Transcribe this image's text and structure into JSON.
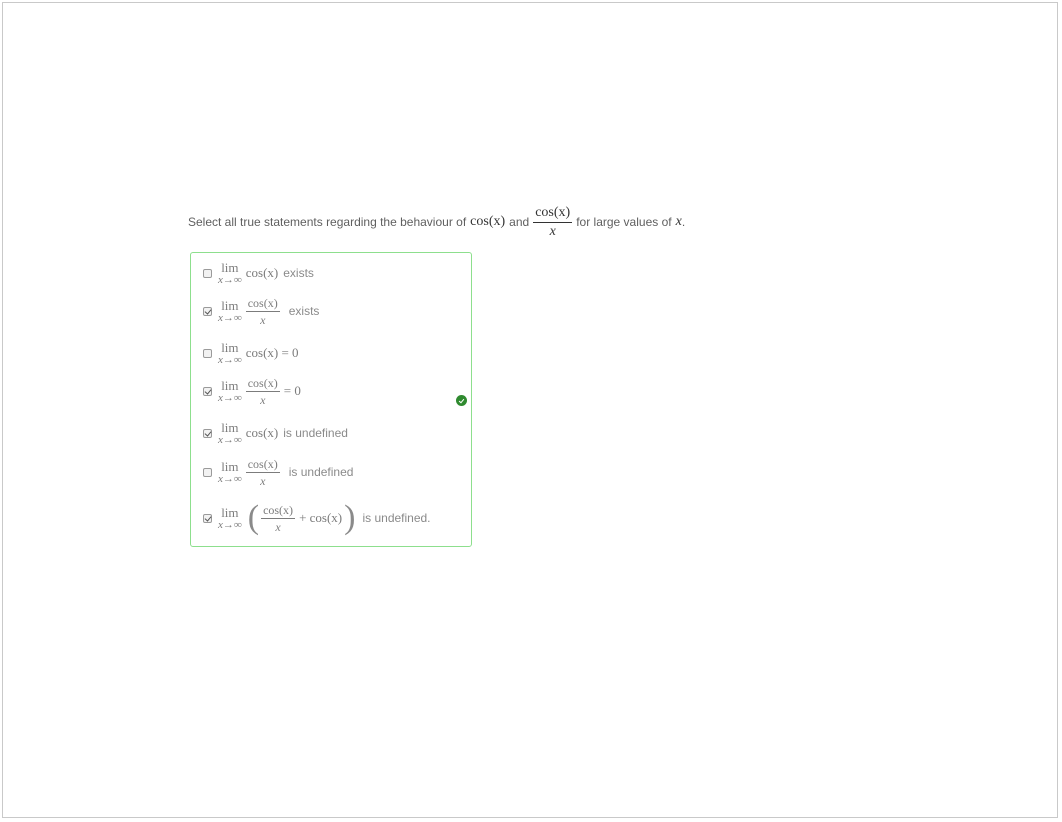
{
  "question": {
    "prefix": "Select all true statements regarding the behaviour of",
    "cos_x": "cos(x)",
    "and": "and",
    "frac_num": "cos(x)",
    "frac_den": "x",
    "suffix": "for large values of",
    "var": "x",
    "period": "."
  },
  "lim": {
    "word": "lim",
    "sub": "x→∞"
  },
  "options": [
    {
      "checked": false,
      "expr": "cos(x)",
      "text": "exists"
    },
    {
      "checked": true,
      "num": "cos(x)",
      "den": "x",
      "text": "exists"
    },
    {
      "checked": false,
      "expr": "cos(x) = 0"
    },
    {
      "checked": true,
      "num": "cos(x)",
      "den": "x",
      "tail": "= 0"
    },
    {
      "checked": true,
      "expr": "cos(x)",
      "text": "is undefined"
    },
    {
      "checked": false,
      "num": "cos(x)",
      "den": "x",
      "text": "is undefined"
    },
    {
      "checked": true,
      "num": "cos(x)",
      "den": "x",
      "plus": "+ cos(x)",
      "text": "is undefined."
    }
  ],
  "status": {
    "icon": "check-circle-icon",
    "color": "#2f8a2f"
  }
}
